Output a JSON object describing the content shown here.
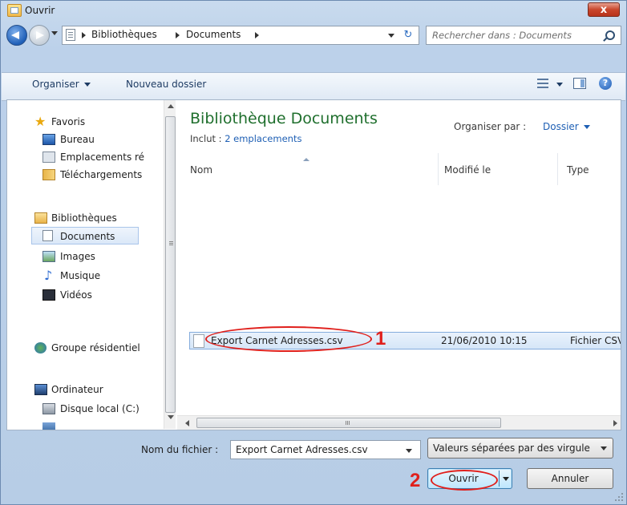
{
  "window": {
    "title": "Ouvrir",
    "close_label": "x"
  },
  "address": {
    "crumbs": [
      "Bibliothèques",
      "Documents"
    ],
    "refresh_glyph": "↻"
  },
  "search": {
    "placeholder": "Rechercher dans : Documents"
  },
  "toolbar": {
    "organize_label": "Organiser",
    "new_folder_label": "Nouveau dossier",
    "help_label": "?"
  },
  "sidebar": {
    "groups": [
      {
        "label": "Favoris",
        "icon": "star-icon"
      },
      {
        "label": "Bureau",
        "icon": "desktop-icon"
      },
      {
        "label": "Emplacements ré",
        "icon": "recent-places-icon"
      },
      {
        "label": "Téléchargements",
        "icon": "downloads-icon"
      },
      {
        "label": "Bibliothèques",
        "icon": "libraries-icon"
      },
      {
        "label": "Documents",
        "icon": "document-icon",
        "selected": true
      },
      {
        "label": "Images",
        "icon": "pictures-icon"
      },
      {
        "label": "Musique",
        "icon": "music-icon"
      },
      {
        "label": "Vidéos",
        "icon": "videos-icon"
      },
      {
        "label": "Groupe résidentiel",
        "icon": "homegroup-icon"
      },
      {
        "label": "Ordinateur",
        "icon": "computer-icon"
      },
      {
        "label": "Disque local (C:)",
        "icon": "drive-icon"
      }
    ]
  },
  "library": {
    "title": "Bibliothèque Documents",
    "includes_prefix": "Inclut :",
    "includes_link": "2 emplacements",
    "arrange_label": "Organiser par :",
    "arrange_value": "Dossier"
  },
  "columns": [
    "Nom",
    "Modifié le",
    "Type"
  ],
  "files": [
    {
      "name": "Export Carnet Adresses.csv",
      "modified": "21/06/2010 10:15",
      "type": "Fichier CSV"
    }
  ],
  "footer": {
    "filename_label": "Nom du fichier :",
    "filename_value": "Export Carnet Adresses.csv",
    "filter_value": "Valeurs séparées par des virgule",
    "open_label": "Ouvrir",
    "cancel_label": "Annuler"
  },
  "annotations": {
    "step1": "1",
    "step2": "2",
    "color": "#e0201c"
  },
  "colors": {
    "accent": "#1e5fb4",
    "library_title": "#1f6f2d",
    "close_button": "#c9462c"
  }
}
